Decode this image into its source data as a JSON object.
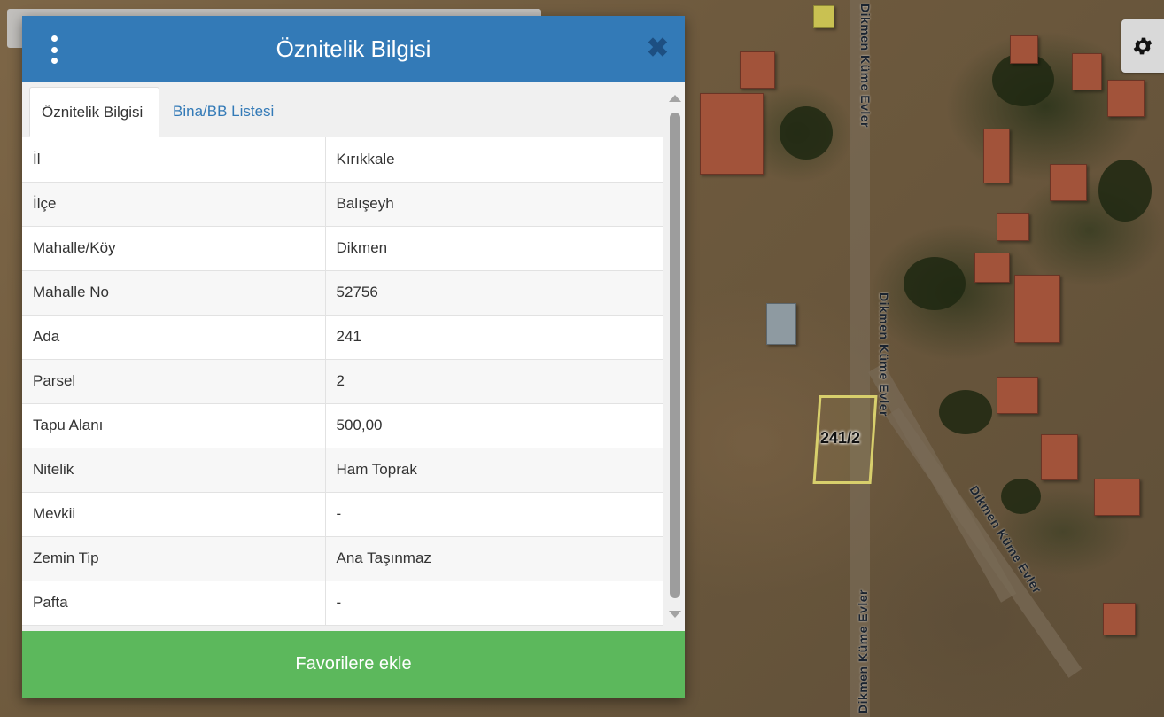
{
  "dialog": {
    "title": "Öznitelik Bilgisi",
    "close_glyph": "✖",
    "tabs": [
      {
        "label": "Öznitelik Bilgisi",
        "active": true
      },
      {
        "label": "Bina/BB Listesi",
        "active": false
      }
    ],
    "rows": [
      {
        "key": "İl",
        "value": "Kırıkkale"
      },
      {
        "key": "İlçe",
        "value": "Balışeyh"
      },
      {
        "key": "Mahalle/Köy",
        "value": "Dikmen"
      },
      {
        "key": "Mahalle No",
        "value": "52756"
      },
      {
        "key": "Ada",
        "value": "241"
      },
      {
        "key": "Parsel",
        "value": "2"
      },
      {
        "key": "Tapu Alanı",
        "value": "500,00"
      },
      {
        "key": "Nitelik",
        "value": "Ham Toprak"
      },
      {
        "key": "Mevkii",
        "value": "-"
      },
      {
        "key": "Zemin Tip",
        "value": "Ana Taşınmaz"
      },
      {
        "key": "Pafta",
        "value": "-"
      }
    ],
    "favorite_button": "Favorilere ekle"
  },
  "map": {
    "parcel_label": "241/2",
    "road_labels": [
      "Dikmen Küme Evler",
      "Dikmen Küme Evler",
      "Dikmen Küme Evler",
      "Dikmen Küme Evler"
    ]
  },
  "colors": {
    "header": "#337ab7",
    "favorite_button": "#5cb85c",
    "parcel_outline": "#d8cf6c"
  },
  "icons": {
    "menu": "kebab-menu-icon",
    "close": "close-icon",
    "settings": "gear-icon"
  }
}
